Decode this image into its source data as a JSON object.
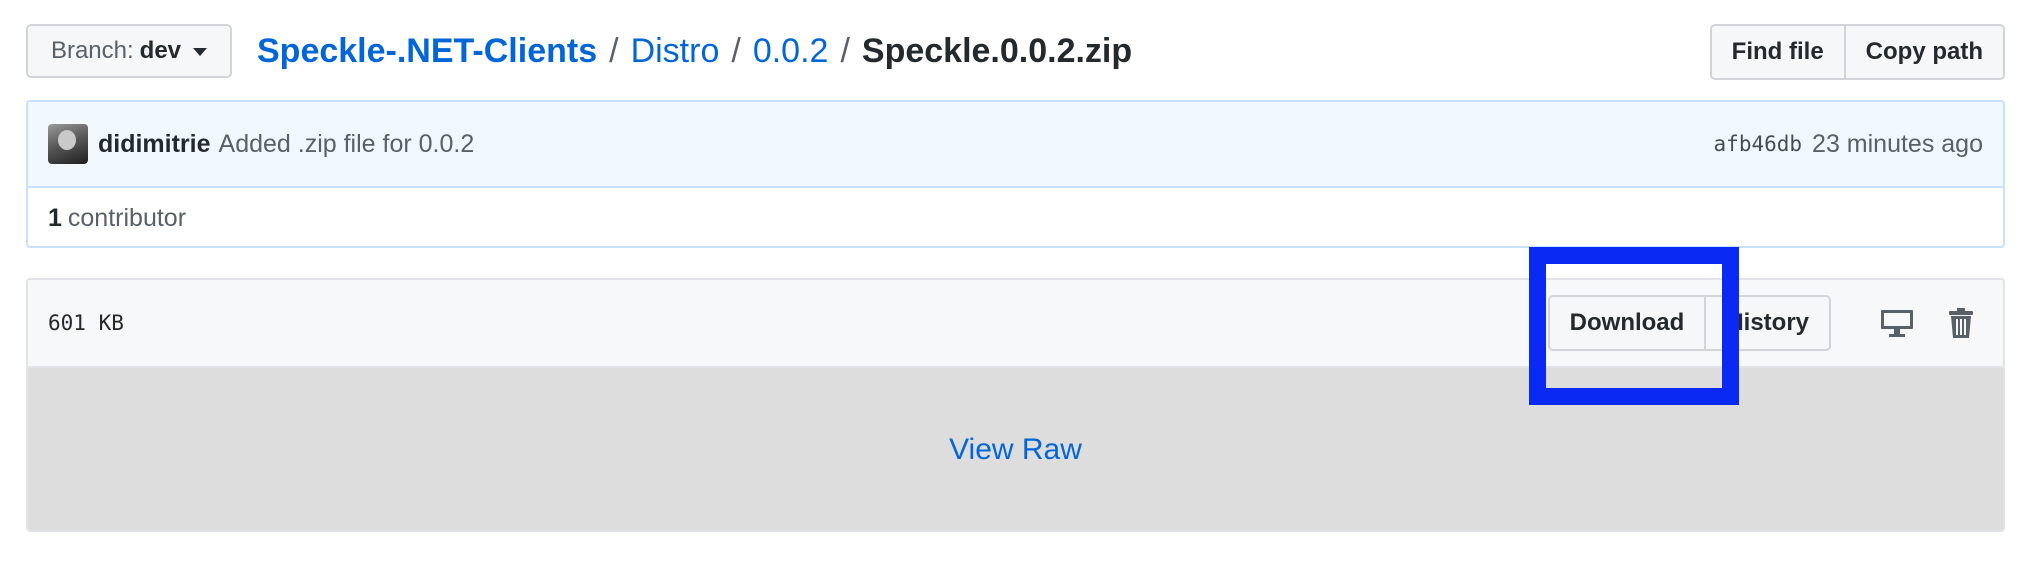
{
  "branch": {
    "label": "Branch:",
    "name": "dev"
  },
  "breadcrumb": {
    "repo": "Speckle-.NET-Clients",
    "separator": "/",
    "path": [
      "Distro",
      "0.0.2"
    ],
    "file": "Speckle.0.0.2.zip"
  },
  "header_actions": {
    "find_file": "Find file",
    "copy_path": "Copy path"
  },
  "commit": {
    "author": "didimitrie",
    "message": "Added .zip file for 0.0.2",
    "sha": "afb46db",
    "time": "23 minutes ago"
  },
  "contributors": {
    "count": "1",
    "label": "contributor"
  },
  "file": {
    "size": "601 KB",
    "download": "Download",
    "history": "History",
    "view_raw": "View Raw"
  },
  "icons": [
    "chevron-down-icon",
    "avatar",
    "desktop-icon",
    "trash-icon"
  ],
  "colors": {
    "link": "#0366d6",
    "highlight": "#0a29f2",
    "commit_bg": "#f1f8ff"
  }
}
